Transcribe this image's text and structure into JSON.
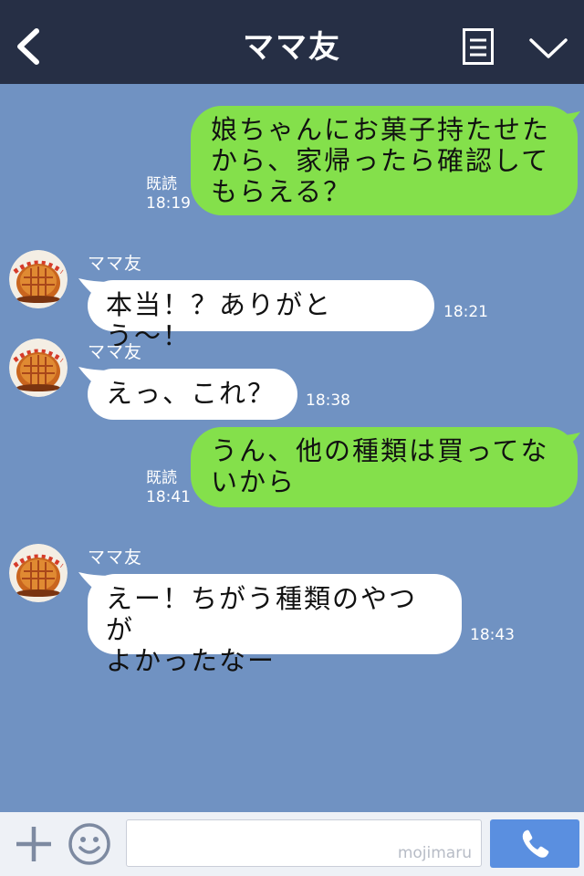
{
  "header": {
    "title": "ママ友",
    "back_icon": "chevron-left-icon",
    "menu_icon": "note-icon",
    "collapse_icon": "chevron-down-icon"
  },
  "messages": [
    {
      "direction": "outgoing",
      "lines": [
        "娘ちゃんにお菓子持たせた",
        "から、家帰ったら確認して",
        "もらえる？"
      ],
      "read_label": "既読",
      "time": "18:19"
    },
    {
      "direction": "incoming",
      "sender": "ママ友",
      "lines": [
        "本当！？ありがとう〜！"
      ],
      "time": "18:21"
    },
    {
      "direction": "incoming",
      "sender": "ママ友",
      "lines": [
        "えっ、これ？"
      ],
      "time": "18:38"
    },
    {
      "direction": "outgoing",
      "lines": [
        "うん、他の種類は買ってな",
        "いから"
      ],
      "read_label": "既読",
      "time": "18:41"
    },
    {
      "direction": "incoming",
      "sender": "ママ友",
      "lines": [
        "えー！ちがう種類のやつが",
        "よかったなー"
      ],
      "time": "18:43"
    }
  ],
  "footer": {
    "plus_icon": "plus-icon",
    "emoji_icon": "smiley-icon",
    "watermark": "mojimaru",
    "call_icon": "phone-icon"
  },
  "colors": {
    "header_bg": "#262f45",
    "chat_bg": "#7092c2",
    "outgoing_bubble": "#84e04b",
    "incoming_bubble": "#ffffff",
    "call_button": "#5a8fe0"
  }
}
